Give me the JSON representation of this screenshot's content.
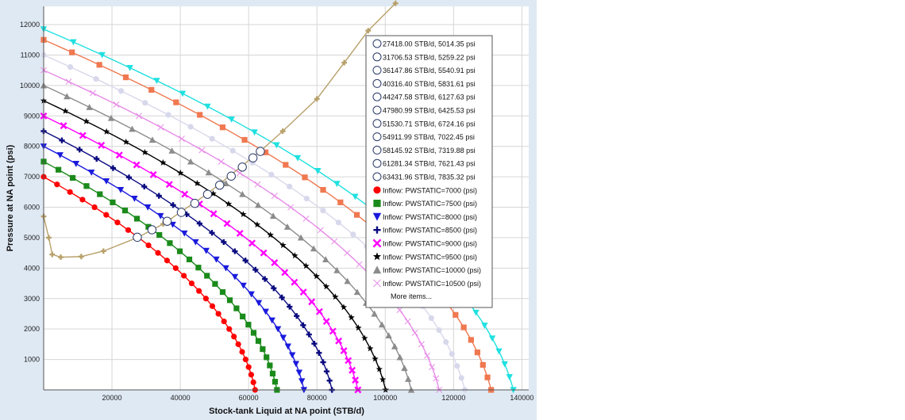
{
  "chart_data": {
    "type": "line",
    "xlabel": "Stock-tank Liquid at NA point (STB/d)",
    "ylabel": "Pressure at NA point (psi)",
    "xlim": [
      0,
      142000
    ],
    "ylim": [
      0,
      12600
    ],
    "x_ticks": [
      "20000",
      "40000",
      "60000",
      "80000",
      "100000",
      "120000",
      "140000"
    ],
    "y_ticks": [
      "1000",
      "2000",
      "3000",
      "4000",
      "5000",
      "6000",
      "7000",
      "8000",
      "9000",
      "10000",
      "11000",
      "12000"
    ],
    "x_tick_values": [
      20000,
      40000,
      60000,
      80000,
      100000,
      120000,
      140000
    ],
    "y_tick_values": [
      1000,
      2000,
      3000,
      4000,
      5000,
      6000,
      7000,
      8000,
      9000,
      10000,
      11000,
      12000
    ],
    "grid": true,
    "outflow_curve": {
      "color": "#b8a06a",
      "marker": "plus",
      "points": [
        [
          0,
          5700
        ],
        [
          1500,
          5000
        ],
        [
          2500,
          4450
        ],
        [
          5000,
          4360
        ],
        [
          11000,
          4380
        ],
        [
          17500,
          4560
        ],
        [
          27400,
          5000
        ],
        [
          35000,
          5450
        ],
        [
          48000,
          6450
        ],
        [
          63400,
          7840
        ],
        [
          70000,
          8500
        ],
        [
          80000,
          9560
        ],
        [
          88000,
          10750
        ],
        [
          95000,
          11800
        ],
        [
          103000,
          12700
        ]
      ]
    },
    "inflow_series": [
      {
        "name": "Inflow: PWSTATIC=7000 (psi)",
        "pws": 7000,
        "qmax": 61900,
        "color": "#ff0000",
        "marker": "circle"
      },
      {
        "name": "Inflow: PWSTATIC=7500 (psi)",
        "pws": 7500,
        "qmax": 68300,
        "color": "#1a8a1a",
        "marker": "square"
      },
      {
        "name": "Inflow: PWSTATIC=8000 (psi)",
        "pws": 8000,
        "qmax": 76200,
        "color": "#1a1adc",
        "marker": "triangle-down"
      },
      {
        "name": "Inflow: PWSTATIC=8500 (psi)",
        "pws": 8500,
        "qmax": 84400,
        "color": "#0a0a80",
        "marker": "plus"
      },
      {
        "name": "Inflow: PWSTATIC=9000 (psi)",
        "pws": 9000,
        "qmax": 92000,
        "color": "#ff00ff",
        "marker": "x"
      },
      {
        "name": "Inflow: PWSTATIC=9500 (psi)",
        "pws": 9500,
        "qmax": 100100,
        "color": "#000000",
        "marker": "star"
      },
      {
        "name": "Inflow: PWSTATIC=10000 (psi)",
        "pws": 10000,
        "qmax": 107600,
        "color": "#8c8c8c",
        "marker": "triangle-up"
      },
      {
        "name": "Inflow: PWSTATIC=10500 (psi)",
        "pws": 10500,
        "qmax": 115800,
        "color": "#e78ce7",
        "marker": "x-thin"
      },
      {
        "name": "",
        "pws": 11000,
        "qmax": 123300,
        "color": "#d8d8ec",
        "marker": "circle"
      },
      {
        "name": "",
        "pws": 11500,
        "qmax": 131000,
        "color": "#f07850",
        "marker": "square"
      },
      {
        "name": "",
        "pws": 11850,
        "qmax": 137500,
        "color": "#20e0e0",
        "marker": "triangle-down"
      }
    ],
    "intersections": [
      {
        "label": "27418.00 STB/d, 5014.35 psi",
        "x": 27418.0,
        "y": 5014.35
      },
      {
        "label": "31706.53 STB/d, 5259.22 psi",
        "x": 31706.53,
        "y": 5259.22
      },
      {
        "label": "36147.86 STB/d, 5540.91 psi",
        "x": 36147.86,
        "y": 5540.91
      },
      {
        "label": "40316.40 STB/d, 5831.61 psi",
        "x": 40316.4,
        "y": 5831.61
      },
      {
        "label": "44247.58 STB/d, 6127.63 psi",
        "x": 44247.58,
        "y": 6127.63
      },
      {
        "label": "47980.99 STB/d, 6425.53 psi",
        "x": 47980.99,
        "y": 6425.53
      },
      {
        "label": "51530.71 STB/d, 6724.16 psi",
        "x": 51530.71,
        "y": 6724.16
      },
      {
        "label": "54911.99 STB/d, 7022.45 psi",
        "x": 54911.99,
        "y": 7022.45
      },
      {
        "label": "58145.92 STB/d, 7319.88 psi",
        "x": 58145.92,
        "y": 7319.88
      },
      {
        "label": "61281.34 STB/d, 7621.43 psi",
        "x": 61281.34,
        "y": 7621.43
      },
      {
        "label": "63431.96 STB/d, 7835.32 psi",
        "x": 63431.96,
        "y": 7835.32
      }
    ],
    "legend_more": "More items...",
    "legend_placement": "top-right"
  }
}
